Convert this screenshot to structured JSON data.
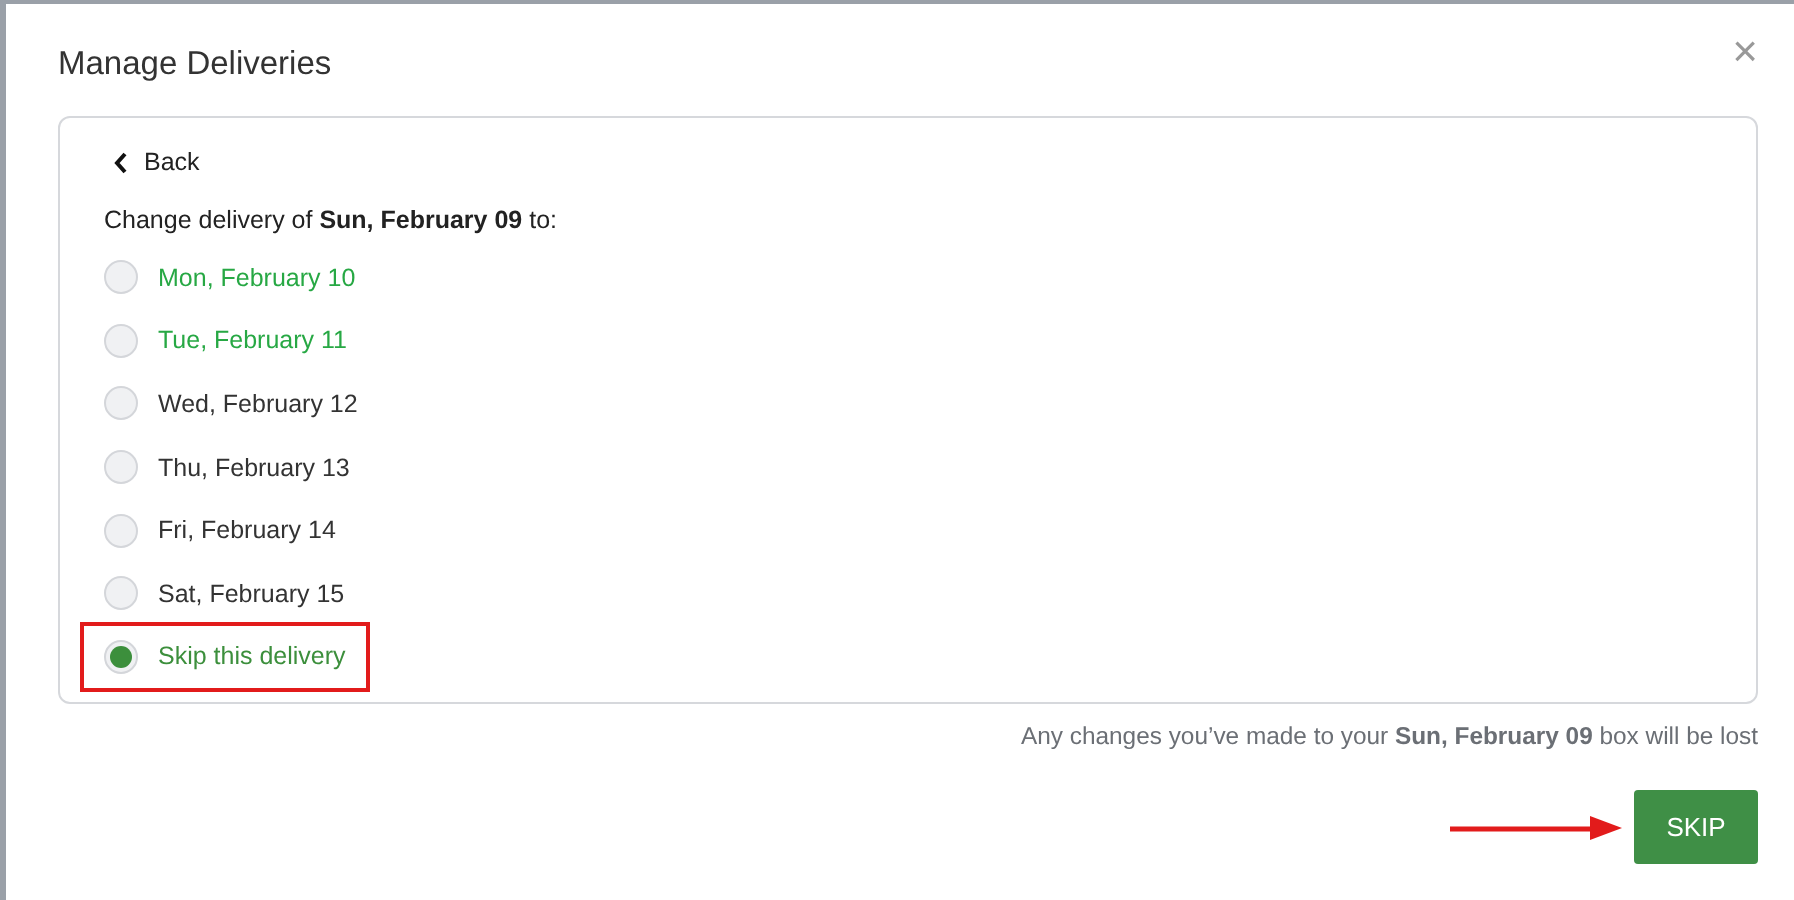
{
  "dialog": {
    "title": "Manage Deliveries",
    "close": "×"
  },
  "card": {
    "back": "Back",
    "prompt": "Change delivery of **Sun, February 09** to:",
    "options": [
      {
        "label": "Mon, February 10",
        "selected": false,
        "color": "#27a844",
        "highlighted": false
      },
      {
        "label": "Tue, February 11",
        "selected": false,
        "color": "#27a844",
        "highlighted": false
      },
      {
        "label": "Wed, February 12",
        "selected": false,
        "color": "#333333",
        "highlighted": false
      },
      {
        "label": "Thu, February 13",
        "selected": false,
        "color": "#333333",
        "highlighted": false
      },
      {
        "label": "Fri, February 14",
        "selected": false,
        "color": "#333333",
        "highlighted": false
      },
      {
        "label": "Sat, February 15",
        "selected": false,
        "color": "#333333",
        "highlighted": false
      },
      {
        "label": "Skip this delivery",
        "selected": true,
        "color": "#3c8f3c",
        "highlighted": true
      }
    ]
  },
  "note": "Any changes you’ve made to your **Sun, February 09** box will be lost",
  "button": {
    "label": "SKIP",
    "pointed": true
  }
}
